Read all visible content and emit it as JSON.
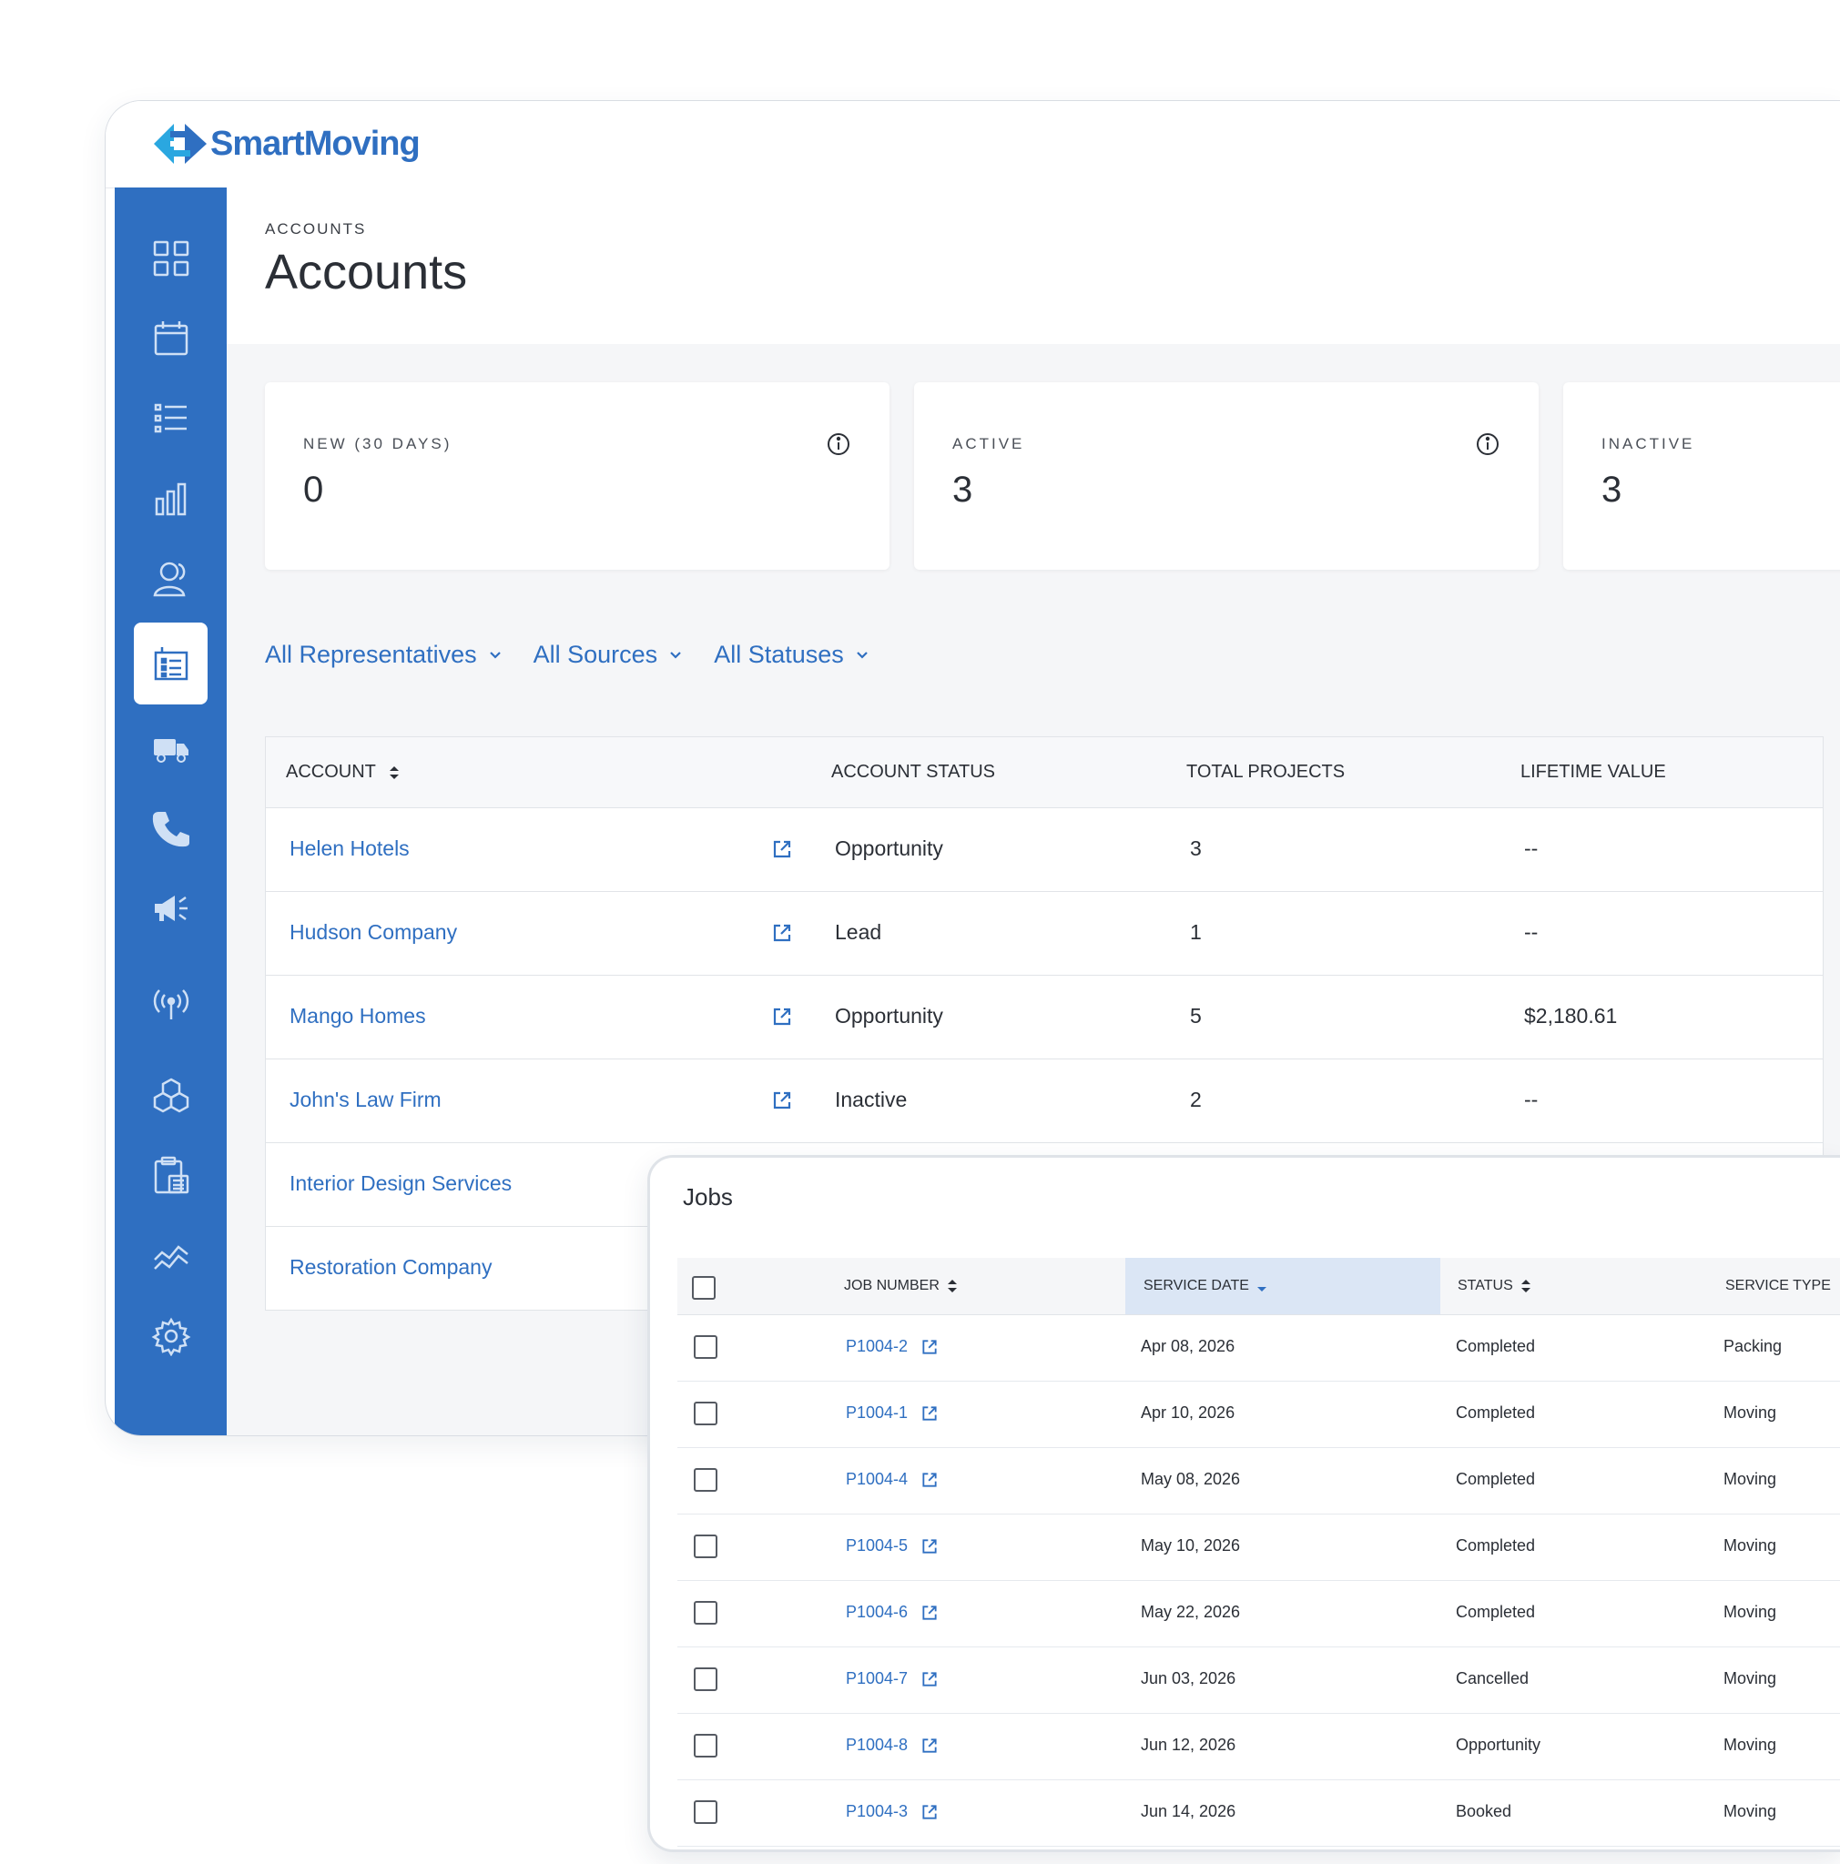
{
  "app": {
    "logo_text": "SmartMoving",
    "colors": {
      "brand": "#2f6fc1",
      "sidebar": "#2f6fc1",
      "accent_sorted": "#dbe6f5"
    }
  },
  "sidebar": {
    "items": [
      {
        "icon": "dashboard-grid-icon",
        "active": false
      },
      {
        "icon": "calendar-icon",
        "active": false
      },
      {
        "icon": "list-icon",
        "active": false
      },
      {
        "icon": "bar-chart-icon",
        "active": false
      },
      {
        "icon": "customers-icon",
        "active": false
      },
      {
        "icon": "building-accounts-icon",
        "active": true
      },
      {
        "icon": "truck-icon",
        "active": false
      },
      {
        "icon": "phone-icon",
        "active": false
      },
      {
        "icon": "megaphone-icon",
        "active": false
      },
      {
        "icon": "broadcast-icon",
        "active": false
      },
      {
        "icon": "boxes-icon",
        "active": false
      },
      {
        "icon": "calculator-clipboard-icon",
        "active": false
      },
      {
        "icon": "trend-icon",
        "active": false
      },
      {
        "icon": "gear-icon",
        "active": false
      }
    ]
  },
  "header": {
    "breadcrumb": "ACCOUNTS",
    "title": "Accounts"
  },
  "cards": [
    {
      "label": "NEW (30 DAYS)",
      "value": "0",
      "info": true
    },
    {
      "label": "ACTIVE",
      "value": "3",
      "info": true
    },
    {
      "label": "INACTIVE",
      "value": "3",
      "info": false
    }
  ],
  "filters": [
    "All Representatives",
    "All Sources",
    "All Statuses"
  ],
  "accounts_table": {
    "headers": {
      "account": "ACCOUNT",
      "status": "ACCOUNT STATUS",
      "projects": "TOTAL PROJECTS",
      "ltv": "LIFETIME VALUE"
    },
    "rows": [
      {
        "name": "Helen Hotels",
        "status": "Opportunity",
        "projects": "3",
        "ltv": "--"
      },
      {
        "name": "Hudson Company",
        "status": "Lead",
        "projects": "1",
        "ltv": "--"
      },
      {
        "name": "Mango Homes",
        "status": "Opportunity",
        "projects": "5",
        "ltv": "$2,180.61"
      },
      {
        "name": "John's Law Firm",
        "status": "Inactive",
        "projects": "2",
        "ltv": "--"
      },
      {
        "name": "Interior Design Services",
        "status": "",
        "projects": "",
        "ltv": ""
      },
      {
        "name": "Restoration Company",
        "status": "",
        "projects": "",
        "ltv": ""
      }
    ]
  },
  "jobs": {
    "title": "Jobs",
    "headers": {
      "job_number": "JOB NUMBER",
      "service_date": "SERVICE DATE",
      "status": "STATUS",
      "service_type": "SERVICE TYPE"
    },
    "rows": [
      {
        "number": "P1004-2",
        "date": "Apr 08, 2026",
        "status": "Completed",
        "type": "Packing"
      },
      {
        "number": "P1004-1",
        "date": "Apr 10, 2026",
        "status": "Completed",
        "type": "Moving"
      },
      {
        "number": "P1004-4",
        "date": "May 08, 2026",
        "status": "Completed",
        "type": "Moving"
      },
      {
        "number": "P1004-5",
        "date": "May 10, 2026",
        "status": "Completed",
        "type": "Moving"
      },
      {
        "number": "P1004-6",
        "date": "May 22, 2026",
        "status": "Completed",
        "type": "Moving"
      },
      {
        "number": "P1004-7",
        "date": "Jun 03, 2026",
        "status": "Cancelled",
        "type": "Moving"
      },
      {
        "number": "P1004-8",
        "date": "Jun 12, 2026",
        "status": "Opportunity",
        "type": "Moving"
      },
      {
        "number": "P1004-3",
        "date": "Jun 14, 2026",
        "status": "Booked",
        "type": "Moving"
      }
    ]
  }
}
